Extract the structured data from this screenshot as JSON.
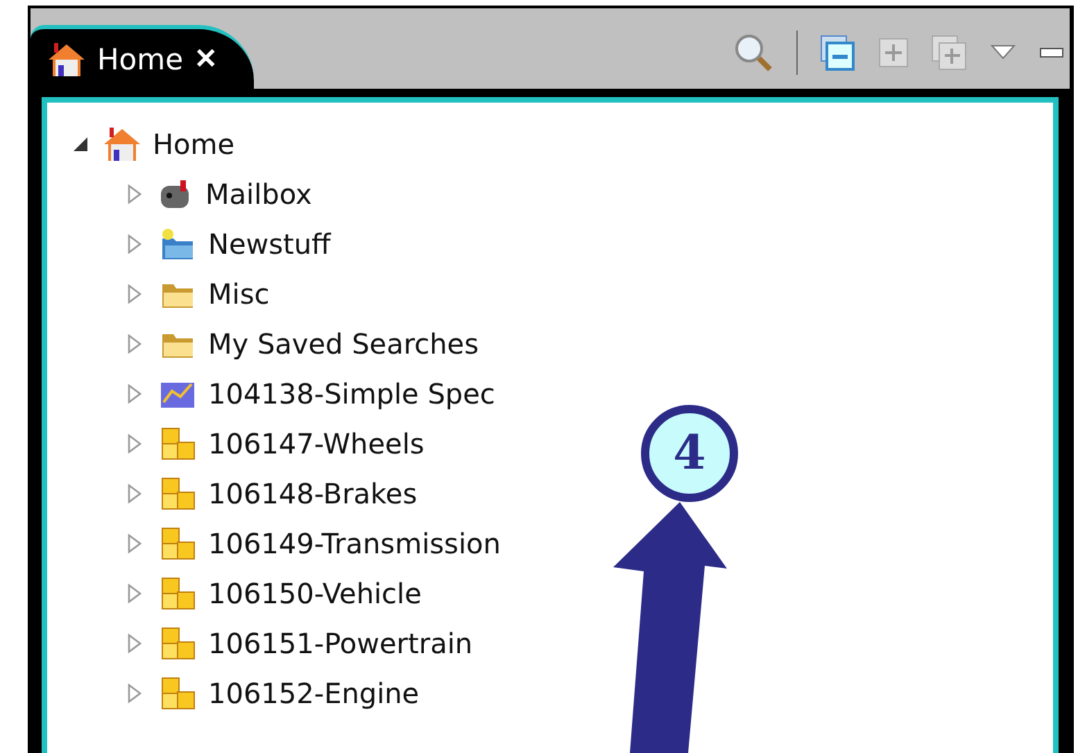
{
  "tab": {
    "label": "Home",
    "close": "✕",
    "selected": true
  },
  "tree": [
    {
      "label": "Home",
      "kind": "home",
      "expanded": true,
      "children": [
        {
          "label": "Mailbox",
          "kind": "mailbox",
          "expanded": false
        },
        {
          "label": "Newstuff",
          "kind": "newfolder",
          "expanded": false
        },
        {
          "label": "Misc",
          "kind": "folder",
          "expanded": false
        },
        {
          "label": "My Saved Searches",
          "kind": "folder",
          "expanded": false
        },
        {
          "label": "104138-Simple Spec",
          "kind": "spec",
          "expanded": false
        },
        {
          "label": "106147-Wheels",
          "kind": "assembly",
          "expanded": false
        },
        {
          "label": "106148-Brakes",
          "kind": "assembly",
          "expanded": false
        },
        {
          "label": "106149-Transmission",
          "kind": "assembly",
          "expanded": false
        },
        {
          "label": "106150-Vehicle",
          "kind": "assembly",
          "expanded": false
        },
        {
          "label": "106151-Powertrain",
          "kind": "assembly",
          "expanded": false
        },
        {
          "label": "106152-Engine",
          "kind": "assembly",
          "expanded": false
        }
      ]
    }
  ],
  "callout": {
    "number": "4"
  }
}
